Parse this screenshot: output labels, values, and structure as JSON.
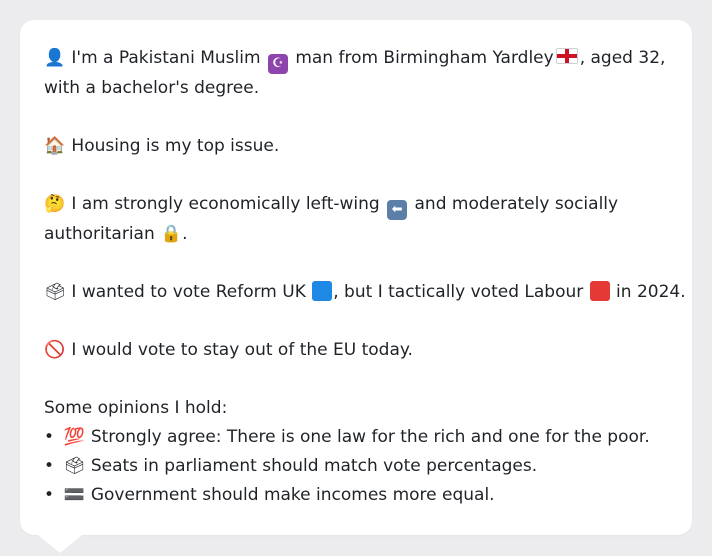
{
  "persona": {
    "intro_emoji": "👤",
    "intro_a": "I'm a Pakistani Muslim",
    "muslim_emoji": "☪",
    "intro_b": "man from Birmingham Yardley",
    "intro_c": ", aged 32,",
    "intro_line2": "with a bachelor's degree.",
    "housing_emoji": "🏠",
    "housing_text": "Housing is my top issue.",
    "think_emoji": "🤔",
    "econ_a": "I am strongly economically left-wing",
    "left_arrow": "⬅",
    "econ_b": "and moderately socially",
    "econ_line2": "authoritarian",
    "lock_emoji": "🔒",
    "econ_line2_end": ".",
    "ballot_emoji": "🗳",
    "vote_a": "I wanted to vote Reform UK",
    "vote_b": ", but I tactically voted Labour",
    "vote_c": "in 2024.",
    "no_emoji": "🚫",
    "eu_text": "I would vote to stay out of the EU today.",
    "opinions_heading": "Some opinions I hold:",
    "opinions": [
      {
        "emoji": "💯",
        "text": "Strongly agree: There is one law for the rich and one for the poor."
      },
      {
        "emoji": "🗳",
        "text": "Seats in parliament should match vote percentages."
      },
      {
        "emoji": "🟰",
        "text": "Government should make incomes more equal."
      }
    ]
  },
  "colors": {
    "muslim_bg": "#8e44ad",
    "arrow_bg": "#5b7fa6",
    "reform_blue": "#1e88e5",
    "labour_red": "#e53935"
  }
}
